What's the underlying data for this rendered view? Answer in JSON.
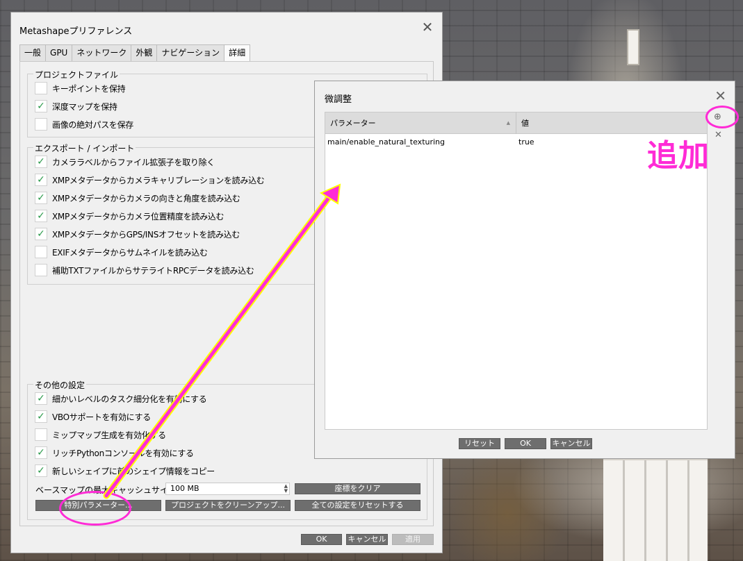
{
  "prefs": {
    "title": "Metashapeプリファレンス",
    "tabs": [
      "一般",
      "GPU",
      "ネットワーク",
      "外観",
      "ナビゲーション",
      "詳細"
    ],
    "active_tab": "詳細",
    "groups": {
      "project": {
        "title": "プロジェクトファイル",
        "items": [
          {
            "label": "キーポイントを保持",
            "checked": false
          },
          {
            "label": "深度マップを保持",
            "checked": true
          },
          {
            "label": "画像の絶対パスを保存",
            "checked": false
          }
        ]
      },
      "export": {
        "title": "エクスポート / インポート",
        "items": [
          {
            "label": "カメララベルからファイル拡張子を取り除く",
            "checked": true
          },
          {
            "label": "XMPメタデータからカメラキャリブレーションを読み込む",
            "checked": true
          },
          {
            "label": "XMPメタデータからカメラの向きと角度を読み込む",
            "checked": true
          },
          {
            "label": "XMPメタデータからカメラ位置精度を読み込む",
            "checked": true
          },
          {
            "label": "XMPメタデータからGPS/INSオフセットを読み込む",
            "checked": true
          },
          {
            "label": "EXIFメタデータからサムネイルを読み込む",
            "checked": false
          },
          {
            "label": "補助TXTファイルからサテライトRPCデータを読み込む",
            "checked": false
          }
        ]
      },
      "misc": {
        "title": "その他の設定",
        "items": [
          {
            "label": "細かいレベルのタスク細分化を有効にする",
            "checked": true
          },
          {
            "label": "VBOサポートを有効にする",
            "checked": true
          },
          {
            "label": "ミップマップ生成を有効化する",
            "checked": false
          },
          {
            "label": "リッチPythonコンソールを有効にする",
            "checked": true
          },
          {
            "label": "新しいシェイプに前のシェイプ情報をコピー",
            "checked": true
          }
        ]
      }
    },
    "basemap_label": "ベースマップの最大キャッシュサイズ:",
    "basemap_value": "100 MB",
    "clear_coords": "座標をクリア",
    "tweaks_button": "特別パラメーター...",
    "cleanup_button": "プロジェクトをクリーンアップ...",
    "reset_all_button": "全ての設定をリセットする",
    "ok": "OK",
    "cancel": "キャンセル",
    "apply": "適用",
    "checkmark": "✓"
  },
  "tweaks": {
    "title": "微調整",
    "columns": [
      "パラメーター",
      "値"
    ],
    "rows": [
      {
        "param": "main/enable_natural_texturing",
        "value": "true"
      }
    ],
    "reset": "リセット",
    "ok": "OK",
    "cancel": "キャンセル"
  },
  "annotation": {
    "add_label": "追加",
    "color": "#ff2bd6"
  }
}
